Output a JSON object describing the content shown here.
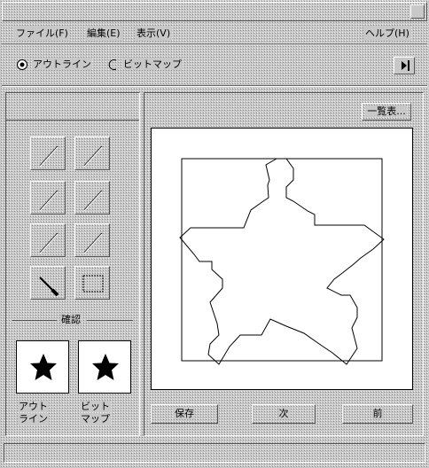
{
  "window": {
    "title": ""
  },
  "menubar": {
    "file": "ファイル(F)",
    "edit": "編集(E)",
    "view": "表示(V)",
    "help": "ヘルプ(H)"
  },
  "mode": {
    "outline": "アウトライン",
    "bitmap": "ビットマップ",
    "selected": "outline"
  },
  "list_button": "一覧表...",
  "tools_label": "確認",
  "preview": {
    "outline_caption_1": "アウト",
    "outline_caption_2": "ライン",
    "bitmap_caption_1": "ビット",
    "bitmap_caption_2": "マップ"
  },
  "buttons": {
    "save": "保存",
    "next": "次",
    "prev": "前"
  },
  "icons": [
    "radio-selected-icon",
    "radio-icon",
    "arrow-right-icon",
    "line-tool-icon",
    "brush-tool-icon",
    "rect-tool-icon",
    "star-icon"
  ]
}
